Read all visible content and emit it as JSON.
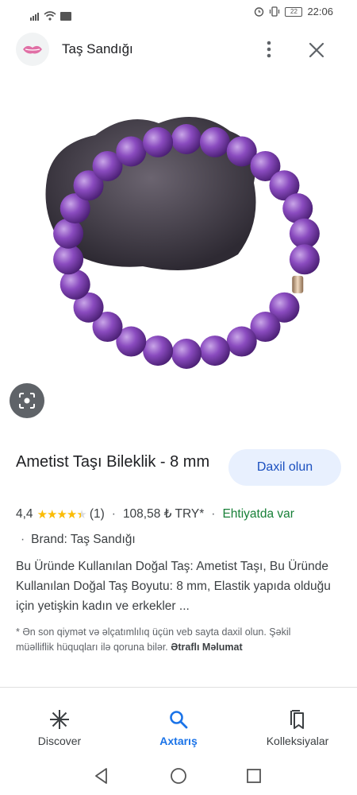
{
  "status_bar": {
    "time": "22:06",
    "battery": "22"
  },
  "app_bar": {
    "site_name": "Taş Sandığı"
  },
  "product": {
    "title": "Ametist Taşı Bileklik - 8 mm",
    "visit_button": "Daxil olun",
    "rating": "4,4",
    "stars": 4.4,
    "reviews": "(1)",
    "price": "108,58 ₺ TRY*",
    "availability": "Ehtiyatda var",
    "brand": "Brand: Taş Sandığı",
    "description": "Bu Üründe Kullanılan Doğal Taş: Ametist Taşı, Bu Üründe Kullanılan Doğal Taş Boyutu: 8 mm, Elastik yapıda olduğu için yetişkin kadın ve erkekler ...",
    "note": "* Ən son qiymət və əlçatımlılıq üçün veb sayta daxil olun. Şəkil müəlliflik hüquqları ilə qoruna bilər.",
    "note_link": "Ətraflı Məlumat"
  },
  "bottom_nav": [
    {
      "label": "Discover",
      "icon": "asterisk-icon"
    },
    {
      "label": "Axtarış",
      "icon": "search-icon",
      "active": true
    },
    {
      "label": "Kolleksiyalar",
      "icon": "collections-icon"
    }
  ],
  "colors": {
    "accent": "#1a73e8",
    "stock_green": "#188038",
    "star": "#fbbc04",
    "button_bg": "#e8f0fe"
  }
}
